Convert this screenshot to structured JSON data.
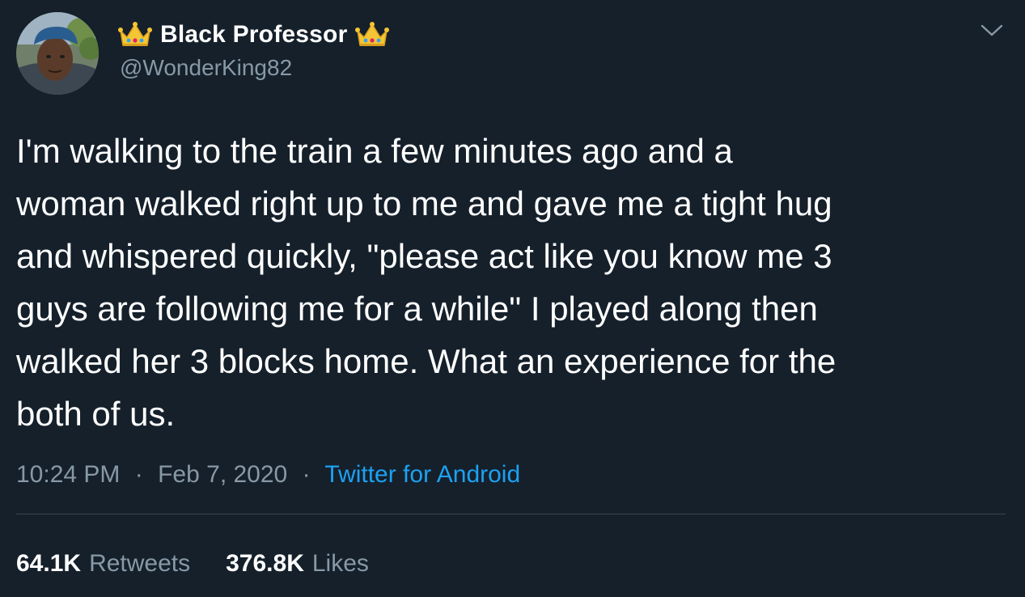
{
  "user": {
    "display_name": "Black Professor",
    "handle": "@WonderKing82",
    "avatar_icon": "profile-photo",
    "name_decoration_icon": "crown-emoji"
  },
  "tweet": {
    "text": "I'm walking to the train a few minutes ago and a\nwoman walked right up to me and gave me a tight hug\nand whispered quickly, \"please act like you know me 3\nguys are following me for a while\" I played along then\nwalked her 3 blocks home. What an experience for the\nboth of us.",
    "time": "10:24 PM",
    "date": "Feb 7, 2020",
    "separator": "·",
    "source": "Twitter for Android"
  },
  "stats": {
    "retweets_count": "64.1K",
    "retweets_label": "Retweets",
    "likes_count": "376.8K",
    "likes_label": "Likes"
  },
  "colors": {
    "background": "#15202b",
    "text_primary": "#ffffff",
    "text_secondary": "#8899a6",
    "link": "#1da1f2",
    "divider": "#38444d"
  }
}
